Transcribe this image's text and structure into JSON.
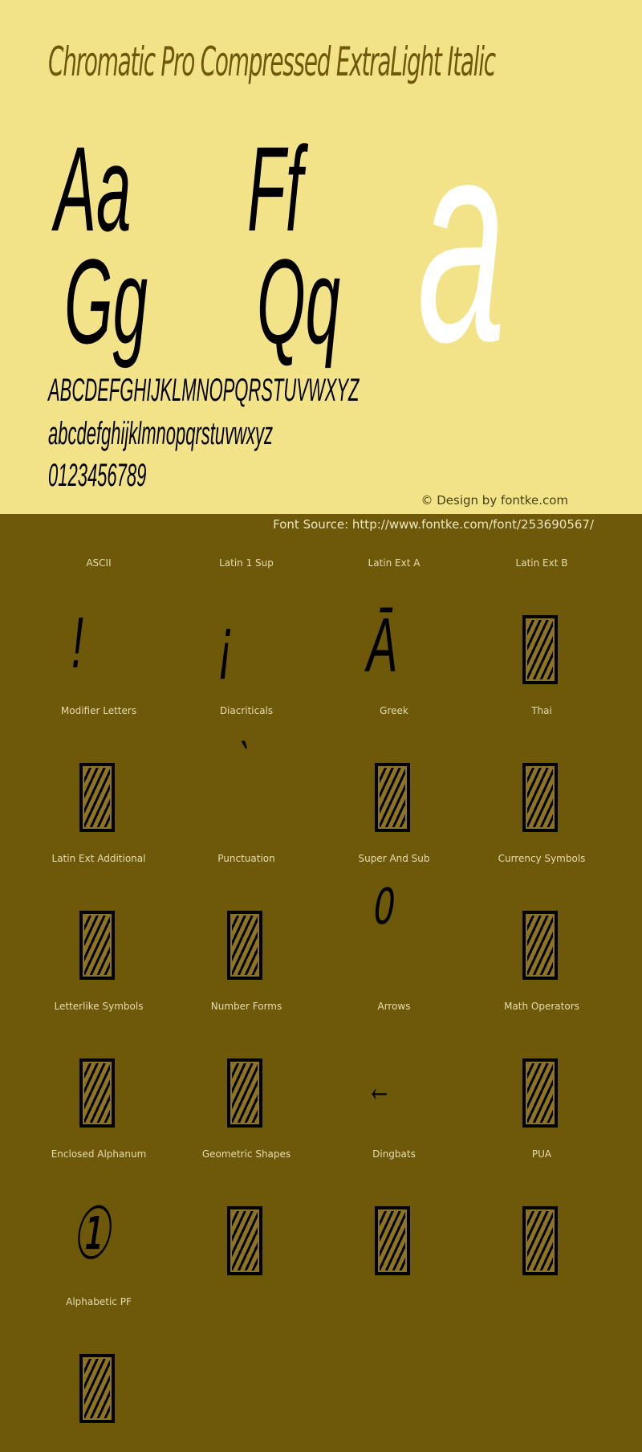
{
  "header": {
    "title": "Chromatic Pro Compressed ExtraLight Italic",
    "specimen_pairs": [
      "Aa",
      "Ff",
      "Gg",
      "Qq"
    ],
    "hero_glyph": "a",
    "uppercase": "ABCDEFGHIJKLMNOPQRSTUVWXYZ",
    "lowercase": "abcdefghijklmnopqrstuvwxyz",
    "digits": "0123456789",
    "credit": "© Design by fontke.com",
    "source": "Font Source: http://www.fontke.com/font/253690567/"
  },
  "colors": {
    "top_bg": "#f3e388",
    "bottom_bg": "#6e590b",
    "title": "#6e590b",
    "hero": "#ffffff"
  },
  "blocks": [
    {
      "label": "ASCII",
      "glyph": "!",
      "missing": false
    },
    {
      "label": "Latin 1 Sup",
      "glyph": "¡",
      "missing": false
    },
    {
      "label": "Latin Ext A",
      "glyph": "Ā",
      "missing": false
    },
    {
      "label": "Latin Ext B",
      "glyph": "",
      "missing": true
    },
    {
      "label": "Modifier Letters",
      "glyph": "",
      "missing": true
    },
    {
      "label": "Diacriticals",
      "glyph": "ˋ",
      "missing": false
    },
    {
      "label": "Greek",
      "glyph": "",
      "missing": true
    },
    {
      "label": "Thai",
      "glyph": "",
      "missing": true
    },
    {
      "label": "Latin Ext Additional",
      "glyph": "",
      "missing": true
    },
    {
      "label": "Punctuation",
      "glyph": "",
      "missing": true
    },
    {
      "label": "Super And Sub",
      "glyph": "⁰",
      "missing": false
    },
    {
      "label": "Currency Symbols",
      "glyph": "",
      "missing": true
    },
    {
      "label": "Letterlike Symbols",
      "glyph": "",
      "missing": true
    },
    {
      "label": "Number Forms",
      "glyph": "",
      "missing": true
    },
    {
      "label": "Arrows",
      "glyph": "←",
      "missing": false
    },
    {
      "label": "Math Operators",
      "glyph": "",
      "missing": true
    },
    {
      "label": "Enclosed Alphanum",
      "glyph": "①",
      "missing": false
    },
    {
      "label": "Geometric Shapes",
      "glyph": "",
      "missing": true
    },
    {
      "label": "Dingbats",
      "glyph": "",
      "missing": true
    },
    {
      "label": "PUA",
      "glyph": "",
      "missing": true
    },
    {
      "label": "Alphabetic PF",
      "glyph": "",
      "missing": true
    }
  ]
}
